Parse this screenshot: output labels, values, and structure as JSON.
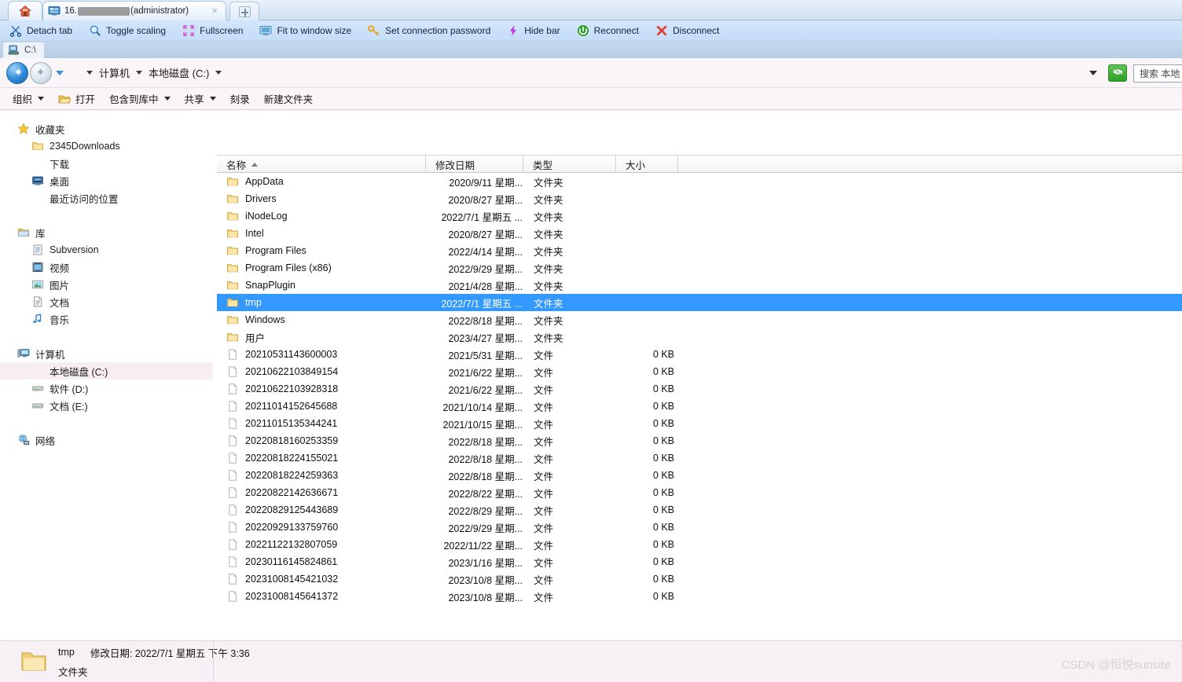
{
  "tabstrip": {
    "home_icon": "home-icon",
    "main_tab": {
      "icon": "remote-desktop-icon",
      "prefix": "16.",
      "redacted": true,
      "suffix": "(administrator)",
      "close": "×"
    },
    "new_tab_label": "+"
  },
  "rdp_toolbar": {
    "items": [
      {
        "icon": "scissors-icon",
        "label": "Detach tab"
      },
      {
        "icon": "magnifier-icon",
        "label": "Toggle scaling"
      },
      {
        "icon": "expand-arrows-icon",
        "label": "Fullscreen"
      },
      {
        "icon": "monitor-icon",
        "label": "Fit to window size"
      },
      {
        "icon": "key-icon",
        "label": "Set connection password"
      },
      {
        "icon": "lightning-icon",
        "label": "Hide bar"
      },
      {
        "icon": "refresh-circle-icon",
        "label": "Reconnect"
      },
      {
        "icon": "x-cross-icon",
        "label": "Disconnect"
      }
    ]
  },
  "explorer": {
    "path_tab": {
      "icon": "computer-small-icon",
      "label": "C:\\"
    },
    "nav": {
      "back_icon": "back-arrow-icon",
      "forward_icon": "forward-arrow-icon",
      "history_icon": "history-dropdown-icon",
      "breadcrumbs": [
        "计算机",
        "本地磁盘 (C:)"
      ],
      "address_dropdown_icon": "chevron-down-icon",
      "refresh_icon": "refresh-icon",
      "search_placeholder": "搜索 本地"
    },
    "commandbar": [
      {
        "label": "组织",
        "has_caret": true,
        "icon": null
      },
      {
        "label": "打开",
        "has_caret": false,
        "icon": "folder-open-icon"
      },
      {
        "label": "包含到库中",
        "has_caret": true,
        "icon": null
      },
      {
        "label": "共享",
        "has_caret": true,
        "icon": null
      },
      {
        "label": "刻录",
        "has_caret": false,
        "icon": null
      },
      {
        "label": "新建文件夹",
        "has_caret": false,
        "icon": null
      }
    ],
    "sidebar": {
      "groups": [
        {
          "header": {
            "label": "收藏夹",
            "icon": "star-icon"
          },
          "items": [
            {
              "label": "2345Downloads",
              "icon": "folder-icon"
            },
            {
              "label": "下载",
              "icon": null
            },
            {
              "label": "桌面",
              "icon": "desktop-icon"
            },
            {
              "label": "最近访问的位置",
              "icon": null
            }
          ]
        },
        {
          "header": {
            "label": "库",
            "icon": "library-icon"
          },
          "items": [
            {
              "label": "Subversion",
              "icon": "doc-icon"
            },
            {
              "label": "视频",
              "icon": "video-icon"
            },
            {
              "label": "图片",
              "icon": "picture-icon"
            },
            {
              "label": "文档",
              "icon": "doc-icon"
            },
            {
              "label": "音乐",
              "icon": "music-icon"
            }
          ]
        },
        {
          "header": {
            "label": "计算机",
            "icon": "computer-icon"
          },
          "items": [
            {
              "label": "本地磁盘 (C:)",
              "icon": null,
              "selected": true
            },
            {
              "label": "软件 (D:)",
              "icon": "drive-icon"
            },
            {
              "label": "文档 (E:)",
              "icon": "drive-icon"
            }
          ]
        },
        {
          "header": {
            "label": "网络",
            "icon": "network-icon"
          },
          "items": []
        }
      ]
    },
    "columns": [
      {
        "key": "name",
        "label": "名称",
        "sorted": "asc"
      },
      {
        "key": "date",
        "label": "修改日期",
        "sorted": null
      },
      {
        "key": "type",
        "label": "类型",
        "sorted": null
      },
      {
        "key": "size",
        "label": "大小",
        "sorted": null
      }
    ],
    "rows": [
      {
        "name": "AppData",
        "date": "2020/9/11 星期...",
        "type": "文件夹",
        "size": "",
        "kind": "folder",
        "selected": false
      },
      {
        "name": "Drivers",
        "date": "2020/8/27 星期...",
        "type": "文件夹",
        "size": "",
        "kind": "folder",
        "selected": false
      },
      {
        "name": "iNodeLog",
        "date": "2022/7/1 星期五 ...",
        "type": "文件夹",
        "size": "",
        "kind": "folder",
        "selected": false
      },
      {
        "name": "Intel",
        "date": "2020/8/27 星期...",
        "type": "文件夹",
        "size": "",
        "kind": "folder",
        "selected": false
      },
      {
        "name": "Program Files",
        "date": "2022/4/14 星期...",
        "type": "文件夹",
        "size": "",
        "kind": "folder",
        "selected": false
      },
      {
        "name": "Program Files (x86)",
        "date": "2022/9/29 星期...",
        "type": "文件夹",
        "size": "",
        "kind": "folder",
        "selected": false
      },
      {
        "name": "SnapPlugin",
        "date": "2021/4/28 星期...",
        "type": "文件夹",
        "size": "",
        "kind": "folder",
        "selected": false
      },
      {
        "name": "tmp",
        "date": "2022/7/1 星期五 ...",
        "type": "文件夹",
        "size": "",
        "kind": "folder",
        "selected": true
      },
      {
        "name": "Windows",
        "date": "2022/8/18 星期...",
        "type": "文件夹",
        "size": "",
        "kind": "folder",
        "selected": false
      },
      {
        "name": "用户",
        "date": "2023/4/27 星期...",
        "type": "文件夹",
        "size": "",
        "kind": "folder",
        "selected": false
      },
      {
        "name": "20210531143600003",
        "date": "2021/5/31 星期...",
        "type": "文件",
        "size": "0 KB",
        "kind": "file",
        "selected": false
      },
      {
        "name": "20210622103849154",
        "date": "2021/6/22 星期...",
        "type": "文件",
        "size": "0 KB",
        "kind": "file",
        "selected": false
      },
      {
        "name": "20210622103928318",
        "date": "2021/6/22 星期...",
        "type": "文件",
        "size": "0 KB",
        "kind": "file",
        "selected": false
      },
      {
        "name": "20211014152645688",
        "date": "2021/10/14 星期...",
        "type": "文件",
        "size": "0 KB",
        "kind": "file",
        "selected": false
      },
      {
        "name": "20211015135344241",
        "date": "2021/10/15 星期...",
        "type": "文件",
        "size": "0 KB",
        "kind": "file",
        "selected": false
      },
      {
        "name": "20220818160253359",
        "date": "2022/8/18 星期...",
        "type": "文件",
        "size": "0 KB",
        "kind": "file",
        "selected": false
      },
      {
        "name": "20220818224155021",
        "date": "2022/8/18 星期...",
        "type": "文件",
        "size": "0 KB",
        "kind": "file",
        "selected": false
      },
      {
        "name": "20220818224259363",
        "date": "2022/8/18 星期...",
        "type": "文件",
        "size": "0 KB",
        "kind": "file",
        "selected": false
      },
      {
        "name": "20220822142636671",
        "date": "2022/8/22 星期...",
        "type": "文件",
        "size": "0 KB",
        "kind": "file",
        "selected": false
      },
      {
        "name": "20220829125443689",
        "date": "2022/8/29 星期...",
        "type": "文件",
        "size": "0 KB",
        "kind": "file",
        "selected": false
      },
      {
        "name": "20220929133759760",
        "date": "2022/9/29 星期...",
        "type": "文件",
        "size": "0 KB",
        "kind": "file",
        "selected": false
      },
      {
        "name": "20221122132807059",
        "date": "2022/11/22 星期...",
        "type": "文件",
        "size": "0 KB",
        "kind": "file",
        "selected": false
      },
      {
        "name": "20230116145824861",
        "date": "2023/1/16 星期...",
        "type": "文件",
        "size": "0 KB",
        "kind": "file",
        "selected": false
      },
      {
        "name": "20231008145421032",
        "date": "2023/10/8 星期...",
        "type": "文件",
        "size": "0 KB",
        "kind": "file",
        "selected": false
      },
      {
        "name": "20231008145641372",
        "date": "2023/10/8 星期...",
        "type": "文件",
        "size": "0 KB",
        "kind": "file",
        "selected": false
      }
    ],
    "statusbar": {
      "icon": "folder-large-icon",
      "name": "tmp",
      "detail": "修改日期: 2022/7/1 星期五 下午 3:36",
      "type": "文件夹"
    }
  },
  "watermark": "CSDN @恒悦sunsite",
  "colors": {
    "selection_blue": "#3399ff",
    "toolbar_blue": "#c5ddf7",
    "explorer_bg": "#f7f1f5",
    "sidebar_selected": "#f6eef3"
  }
}
